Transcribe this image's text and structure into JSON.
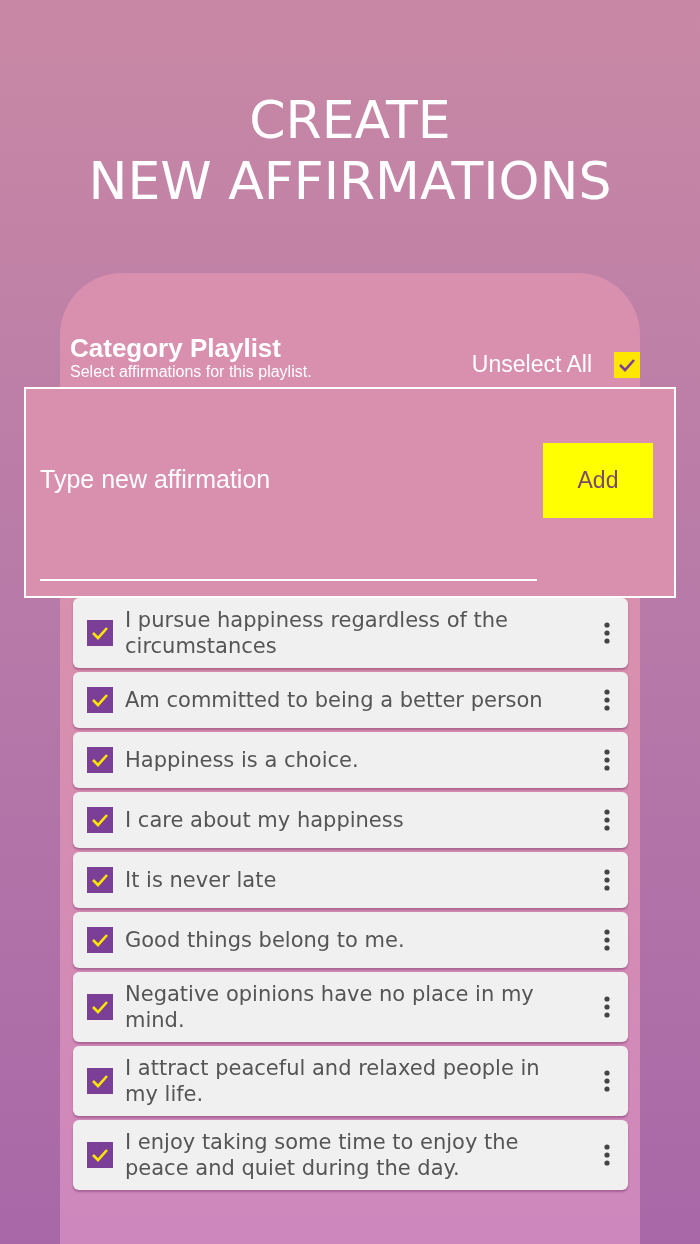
{
  "headline": [
    "CREATE",
    "NEW AFFIRMATIONS"
  ],
  "playlist": {
    "title": "Category Playlist",
    "subtitle": "Select affirmations for this playlist.",
    "unselect_all": {
      "label": "Unselect All",
      "checked": true
    }
  },
  "new_affirmation": {
    "placeholder": "Type new affirmation",
    "button": "Add"
  },
  "affirmations": [
    {
      "text": "I pursue happiness regardless of the circumstances",
      "checked": true
    },
    {
      "text": "Am committed to being a better person",
      "checked": true
    },
    {
      "text": "Happiness is a choice.",
      "checked": true
    },
    {
      "text": "I care about my happiness",
      "checked": true
    },
    {
      "text": "It is never late",
      "checked": true
    },
    {
      "text": "Good things belong to me.",
      "checked": true
    },
    {
      "text": "Negative opinions have no place in my mind.",
      "checked": true
    },
    {
      "text": "I attract peaceful and relaxed people in my life.",
      "checked": true
    },
    {
      "text": "I enjoy taking some time to enjoy the peace and quiet during the day.",
      "checked": true
    }
  ]
}
